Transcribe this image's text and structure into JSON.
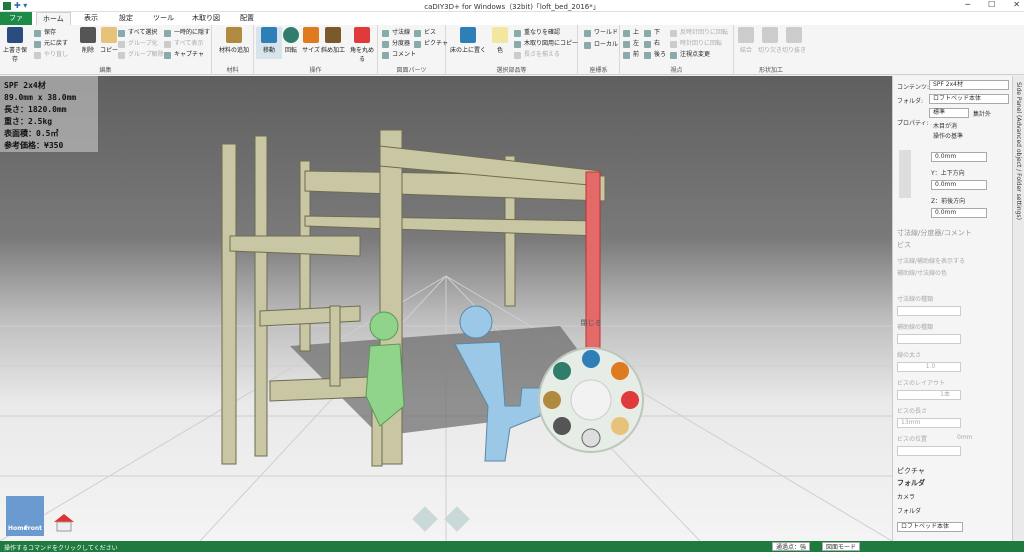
{
  "window": {
    "title": "caDIY3D+ for Windows（32bit)「loft_bed_2016*」"
  },
  "tabs": [
    {
      "label": "ファイル"
    },
    {
      "label": "ホーム"
    },
    {
      "label": "表示"
    },
    {
      "label": "設定"
    },
    {
      "label": "ツール"
    },
    {
      "label": "木取り図"
    },
    {
      "label": "配置"
    }
  ],
  "ribbon": {
    "edit": {
      "label": "編集",
      "save_overwrite": "上書き保存",
      "save": "保存",
      "undo": "元に戻す",
      "redo": "やり直し",
      "delete": "削除",
      "copy": "コピー",
      "select_all": "すべて選択",
      "group": "グループ化",
      "ungroup": "グループ解除",
      "hide_temp": "一時的に隠す",
      "show_all": "すべて表示",
      "capture": "キャプチャ"
    },
    "material": {
      "label": "材料",
      "add_material": "材料の追加"
    },
    "operation": {
      "label": "操作",
      "move": "移動",
      "rotate": "回転",
      "size": "サイズ",
      "oblique": "斜め加工",
      "round": "角を丸める"
    },
    "drawing_parts": {
      "label": "図面パーツ",
      "dimension": "寸法線",
      "divider": "分度器",
      "comment": "コメント",
      "screw": "ビス",
      "picture": "ピクチャ"
    },
    "selected_parts": {
      "label": "選択部品等",
      "place_on_floor": "床の上に置く",
      "color": "色",
      "check_overlap": "重なりを確認",
      "copy_wood": "木取り図用にコピー",
      "align_length": "長さを揃える"
    },
    "coords": {
      "label": "座標系",
      "world": "ワールド",
      "local": "ローカル"
    },
    "view": {
      "label": "視点",
      "top": "上",
      "bottom": "下",
      "left": "左",
      "right": "右",
      "front": "前",
      "back": "後ろ",
      "ccw": "反時計回りに回転",
      "cw": "時計回りに回転",
      "change_focus": "注視点変更"
    },
    "shape": {
      "label": "形状加工",
      "join": "結合",
      "cut": "切り欠き",
      "cutout": "切り抜き"
    }
  },
  "info": {
    "lines": [
      "SPF 2x4材",
      "89.0mm x 38.0mm",
      "長さ：1820.0mm",
      "重さ：2.5kg",
      "表面積：0.5㎡",
      "参考価格：¥350"
    ]
  },
  "radial_menu": {
    "close_label": "閉じる"
  },
  "side_panel": {
    "vertical_title": "Side Panel (Advanced object / Folder settings)",
    "content_label": "コンテンツ:",
    "content_value": "SPF 2x4材",
    "folder_label": "フォルダ:",
    "folder_value": "ロフトベッド本体",
    "property_label": "プロパティ:",
    "style_value": "標準",
    "not_counted": "集計外",
    "wood_grain": "木目が消",
    "op_base": "操作の基準",
    "x_value": "0.0mm",
    "y_label": "Y：上下方向",
    "y_value": "0.0mm",
    "z_label": "Z：前後方向",
    "z_value": "0.0mm",
    "dim_section": "寸法線/分度器/コメント",
    "screw_section": "ビス",
    "show_dims": "寸法線/補助線を表示する",
    "aux_color": "補助線/寸法線の色",
    "dim_type": "寸法線の種類",
    "aux_type": "補助線の種類",
    "line_width": "線の太さ",
    "line_width_value": "1.0",
    "screw_layout": "ビスのレイアウト",
    "screw_layout_value": "1本",
    "screw_length": "ビスの長さ",
    "screw_length_value": "13mm",
    "screw_pos": "ビスの位置",
    "screw_pos_value": "0mm",
    "picture_section": "ピクチャ",
    "folder_section": "フォルダ",
    "camera": "カメラ",
    "folder_row_label": "フォルダ",
    "folder_item": "ロフトベッド本体"
  },
  "nav": {
    "home": "Home",
    "front": "Front"
  },
  "status": {
    "message": "操作するコマンドをクリックしてください",
    "snap": "通過点：強",
    "mode": "図面モード"
  }
}
